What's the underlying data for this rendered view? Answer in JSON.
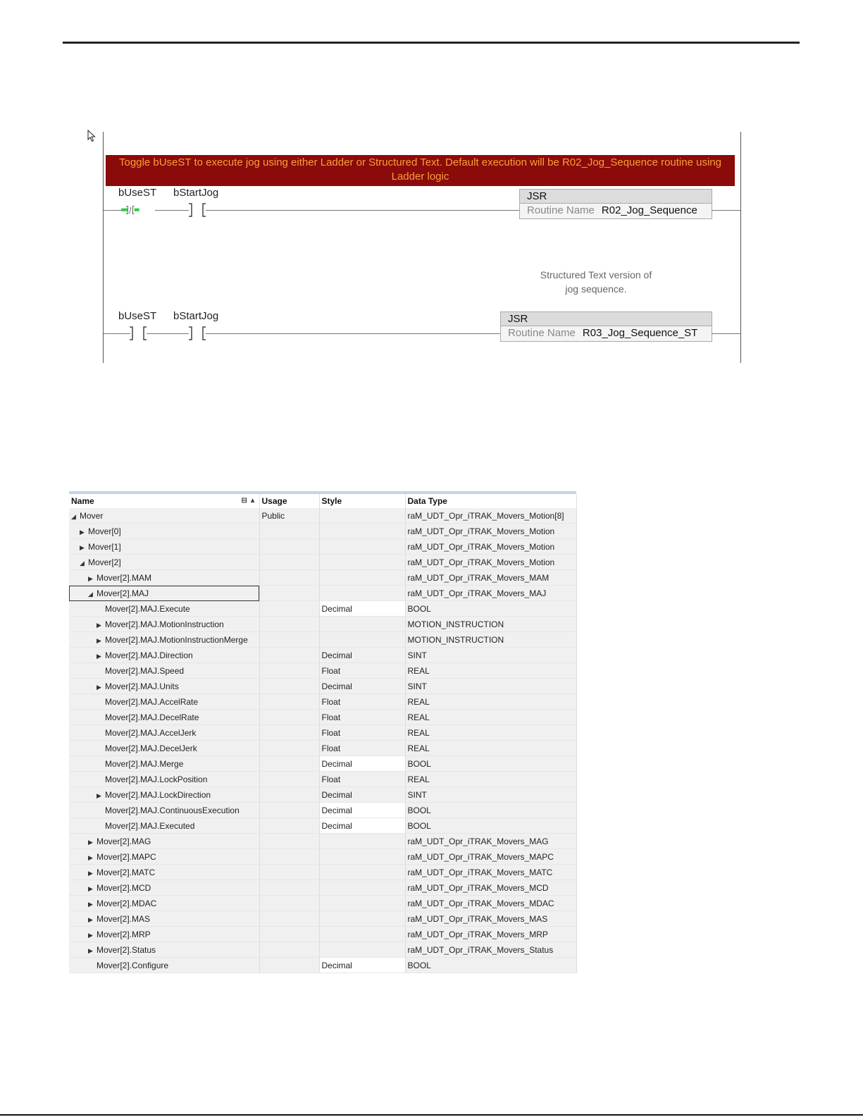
{
  "ladder": {
    "banner": "Toggle bUseST to execute jog using either Ladder or Structured Text. Default execution will be R02_Jog_Sequence routine using Ladder logic",
    "rung1": {
      "contact1_tag": "bUseST",
      "contact2_tag": "bStartJog",
      "jsr_title": "JSR",
      "routine_label": "Routine Name",
      "routine_value": "R02_Jog_Sequence"
    },
    "rung2": {
      "comment": "Structured Text version of jog sequence.",
      "contact1_tag": "bUseST",
      "contact2_tag": "bStartJog",
      "jsr_title": "JSR",
      "routine_label": "Routine Name",
      "routine_value": "R03_Jog_Sequence_ST"
    },
    "colors": {
      "banner_bg": "#8b0a0a",
      "banner_text": "#f7a13a",
      "energized": "#2ecc40"
    }
  },
  "grid": {
    "headers": {
      "name": "Name",
      "usage": "Usage",
      "style": "Style",
      "data_type": "Data Type"
    },
    "rows": [
      {
        "indent": 0,
        "exp": "open",
        "name": "Mover",
        "usage": "Public",
        "style": "",
        "type": "raM_UDT_Opr_iTRAK_Movers_Motion[8]"
      },
      {
        "indent": 1,
        "exp": "closed",
        "name": "Mover[0]",
        "usage": "",
        "style": "",
        "type": "raM_UDT_Opr_iTRAK_Movers_Motion"
      },
      {
        "indent": 1,
        "exp": "closed",
        "name": "Mover[1]",
        "usage": "",
        "style": "",
        "type": "raM_UDT_Opr_iTRAK_Movers_Motion"
      },
      {
        "indent": 1,
        "exp": "open",
        "name": "Mover[2]",
        "usage": "",
        "style": "",
        "type": "raM_UDT_Opr_iTRAK_Movers_Motion"
      },
      {
        "indent": 2,
        "exp": "closed",
        "name": "Mover[2].MAM",
        "usage": "",
        "style": "",
        "type": "raM_UDT_Opr_iTRAK_Movers_MAM"
      },
      {
        "indent": 2,
        "exp": "open",
        "name": "Mover[2].MAJ",
        "usage": "",
        "style": "",
        "type": "raM_UDT_Opr_iTRAK_Movers_MAJ",
        "selected": true
      },
      {
        "indent": 3,
        "exp": "",
        "name": "Mover[2].MAJ.Execute",
        "usage": "",
        "style": "Decimal",
        "type": "BOOL"
      },
      {
        "indent": 3,
        "exp": "closed",
        "name": "Mover[2].MAJ.MotionInstruction",
        "usage": "",
        "style": "",
        "type": "MOTION_INSTRUCTION"
      },
      {
        "indent": 3,
        "exp": "closed",
        "name": "Mover[2].MAJ.MotionInstructionMerge",
        "usage": "",
        "style": "",
        "type": "MOTION_INSTRUCTION"
      },
      {
        "indent": 3,
        "exp": "closed",
        "name": "Mover[2].MAJ.Direction",
        "usage": "",
        "style": "Decimal",
        "type": "SINT"
      },
      {
        "indent": 3,
        "exp": "",
        "name": "Mover[2].MAJ.Speed",
        "usage": "",
        "style": "Float",
        "type": "REAL"
      },
      {
        "indent": 3,
        "exp": "closed",
        "name": "Mover[2].MAJ.Units",
        "usage": "",
        "style": "Decimal",
        "type": "SINT"
      },
      {
        "indent": 3,
        "exp": "",
        "name": "Mover[2].MAJ.AccelRate",
        "usage": "",
        "style": "Float",
        "type": "REAL"
      },
      {
        "indent": 3,
        "exp": "",
        "name": "Mover[2].MAJ.DecelRate",
        "usage": "",
        "style": "Float",
        "type": "REAL"
      },
      {
        "indent": 3,
        "exp": "",
        "name": "Mover[2].MAJ.AccelJerk",
        "usage": "",
        "style": "Float",
        "type": "REAL"
      },
      {
        "indent": 3,
        "exp": "",
        "name": "Mover[2].MAJ.DecelJerk",
        "usage": "",
        "style": "Float",
        "type": "REAL"
      },
      {
        "indent": 3,
        "exp": "",
        "name": "Mover[2].MAJ.Merge",
        "usage": "",
        "style": "Decimal",
        "type": "BOOL"
      },
      {
        "indent": 3,
        "exp": "",
        "name": "Mover[2].MAJ.LockPosition",
        "usage": "",
        "style": "Float",
        "type": "REAL"
      },
      {
        "indent": 3,
        "exp": "closed",
        "name": "Mover[2].MAJ.LockDirection",
        "usage": "",
        "style": "Decimal",
        "type": "SINT"
      },
      {
        "indent": 3,
        "exp": "",
        "name": "Mover[2].MAJ.ContinuousExecution",
        "usage": "",
        "style": "Decimal",
        "type": "BOOL"
      },
      {
        "indent": 3,
        "exp": "",
        "name": "Mover[2].MAJ.Executed",
        "usage": "",
        "style": "Decimal",
        "type": "BOOL"
      },
      {
        "indent": 2,
        "exp": "closed",
        "name": "Mover[2].MAG",
        "usage": "",
        "style": "",
        "type": "raM_UDT_Opr_iTRAK_Movers_MAG"
      },
      {
        "indent": 2,
        "exp": "closed",
        "name": "Mover[2].MAPC",
        "usage": "",
        "style": "",
        "type": "raM_UDT_Opr_iTRAK_Movers_MAPC"
      },
      {
        "indent": 2,
        "exp": "closed",
        "name": "Mover[2].MATC",
        "usage": "",
        "style": "",
        "type": "raM_UDT_Opr_iTRAK_Movers_MATC"
      },
      {
        "indent": 2,
        "exp": "closed",
        "name": "Mover[2].MCD",
        "usage": "",
        "style": "",
        "type": "raM_UDT_Opr_iTRAK_Movers_MCD"
      },
      {
        "indent": 2,
        "exp": "closed",
        "name": "Mover[2].MDAC",
        "usage": "",
        "style": "",
        "type": "raM_UDT_Opr_iTRAK_Movers_MDAC"
      },
      {
        "indent": 2,
        "exp": "closed",
        "name": "Mover[2].MAS",
        "usage": "",
        "style": "",
        "type": "raM_UDT_Opr_iTRAK_Movers_MAS"
      },
      {
        "indent": 2,
        "exp": "closed",
        "name": "Mover[2].MRP",
        "usage": "",
        "style": "",
        "type": "raM_UDT_Opr_iTRAK_Movers_MRP"
      },
      {
        "indent": 2,
        "exp": "closed",
        "name": "Mover[2].Status",
        "usage": "",
        "style": "",
        "type": "raM_UDT_Opr_iTRAK_Movers_Status"
      },
      {
        "indent": 2,
        "exp": "",
        "name": "Mover[2].Configure",
        "usage": "",
        "style": "Decimal",
        "type": "BOOL"
      }
    ]
  }
}
